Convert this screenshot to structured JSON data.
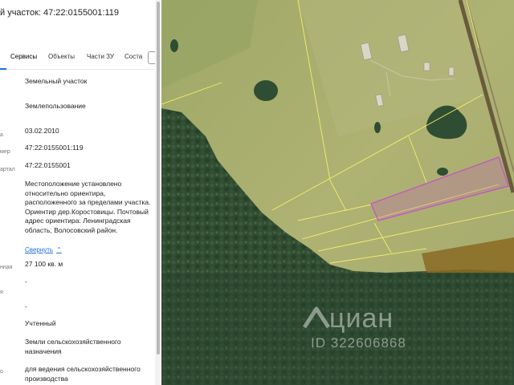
{
  "panel": {
    "title": "й участок: 47:22:0155001:119",
    "tabs": [
      "Сервисы",
      "Объекты",
      "Части ЗУ",
      "Соста"
    ],
    "fields": [
      {
        "label": "",
        "value": "Земельный участок"
      },
      {
        "label": "",
        "value": "Землепользование"
      },
      {
        "label": "а",
        "value": "03.02.2010"
      },
      {
        "label": "мер",
        "value": "47:22:0155001:119"
      },
      {
        "label": "артал",
        "value": "47:22:0155001"
      },
      {
        "label": "",
        "value": "Местоположение установлено относительно ориентира, расположенного за пределами участка. Ориентир дер.Коростовицы. Почтовый адрес ориентира: Ленинградская область, Волосовский район."
      },
      {
        "label": "нная",
        "value": "27 100 кв. м"
      },
      {
        "label": "я",
        "value": "-"
      },
      {
        "label": "",
        "value": "-"
      },
      {
        "label": "",
        "value": "Учтенный"
      },
      {
        "label": "",
        "value": "Земли сельскохозяйственного назначения"
      },
      {
        "label": "о",
        "value": "для ведения сельскохозяйственного производства"
      }
    ],
    "toggle": "Свернуть"
  },
  "map": {
    "watermark_brand": "циан",
    "watermark_id": "ID 322606868",
    "colors": {
      "field": "#a6ab6a",
      "forest": "#2e4a30",
      "parcel": "#c455c2",
      "boundary": "#f2ee6a",
      "road": "#6a5a3c",
      "brown_plot": "#8a6a22"
    }
  }
}
